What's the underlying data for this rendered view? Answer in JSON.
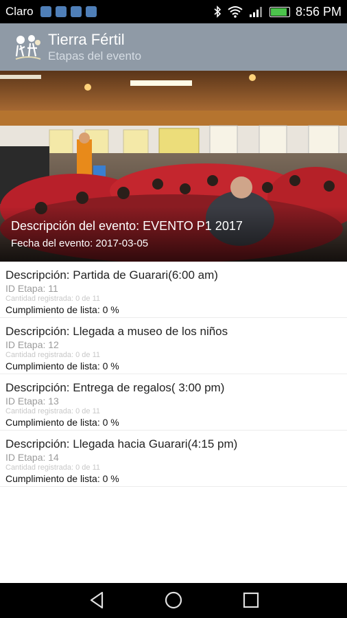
{
  "status": {
    "carrier": "Claro",
    "time": "8:56 PM",
    "battery_level": 0.9
  },
  "appbar": {
    "title": "Tierra Fértil",
    "subtitle": "Etapas del evento"
  },
  "hero": {
    "description": "Descripción del evento: EVENTO P1 2017",
    "date": "Fecha del evento: 2017-03-05"
  },
  "stages": [
    {
      "description": "Descripción: Partida de Guarari(6:00 am)",
      "id": "ID Etapa: 11",
      "count": "Cantidad registrada: 0 de 11",
      "completion": "Cumplimiento de lista: 0 %"
    },
    {
      "description": "Descripción: Llegada a museo de los niños",
      "id": "ID Etapa: 12",
      "count": "Cantidad registrada: 0 de 11",
      "completion": "Cumplimiento de lista: 0 %"
    },
    {
      "description": "Descripción: Entrega de regalos( 3:00 pm)",
      "id": "ID Etapa: 13",
      "count": "Cantidad registrada: 0 de 11",
      "completion": "Cumplimiento de lista: 0 %"
    },
    {
      "description": "Descripción: Llegada hacia Guarari(4:15 pm)",
      "id": "ID Etapa: 14",
      "count": "Cantidad registrada: 0 de 11",
      "completion": "Cumplimiento de lista: 0 %"
    }
  ],
  "icons": {
    "notifications": [
      "notification-icon",
      "usb-icon",
      "image-icon",
      "message-icon"
    ],
    "status": [
      "bluetooth-icon",
      "wifi-icon",
      "signal-icon",
      "battery-icon"
    ],
    "nav": [
      "back-icon",
      "home-icon",
      "recents-icon"
    ]
  },
  "colors": {
    "appbar": "#8f9aa6",
    "battery": "#4cc34c",
    "statusbar": "#000000"
  }
}
